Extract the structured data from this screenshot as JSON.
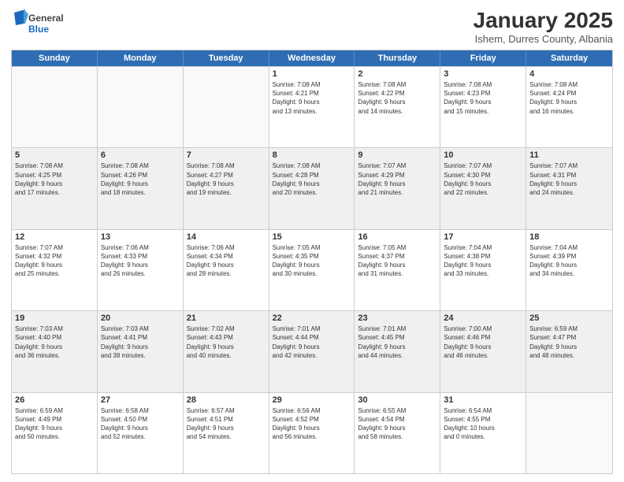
{
  "logo": {
    "general": "General",
    "blue": "Blue"
  },
  "header": {
    "month": "January 2025",
    "location": "Ishem, Durres County, Albania"
  },
  "weekdays": [
    "Sunday",
    "Monday",
    "Tuesday",
    "Wednesday",
    "Thursday",
    "Friday",
    "Saturday"
  ],
  "rows": [
    [
      {
        "day": "",
        "info": "",
        "empty": true
      },
      {
        "day": "",
        "info": "",
        "empty": true
      },
      {
        "day": "",
        "info": "",
        "empty": true
      },
      {
        "day": "1",
        "info": "Sunrise: 7:08 AM\nSunset: 4:21 PM\nDaylight: 9 hours\nand 13 minutes."
      },
      {
        "day": "2",
        "info": "Sunrise: 7:08 AM\nSunset: 4:22 PM\nDaylight: 9 hours\nand 14 minutes."
      },
      {
        "day": "3",
        "info": "Sunrise: 7:08 AM\nSunset: 4:23 PM\nDaylight: 9 hours\nand 15 minutes."
      },
      {
        "day": "4",
        "info": "Sunrise: 7:08 AM\nSunset: 4:24 PM\nDaylight: 9 hours\nand 16 minutes."
      }
    ],
    [
      {
        "day": "5",
        "info": "Sunrise: 7:08 AM\nSunset: 4:25 PM\nDaylight: 9 hours\nand 17 minutes.",
        "shaded": true
      },
      {
        "day": "6",
        "info": "Sunrise: 7:08 AM\nSunset: 4:26 PM\nDaylight: 9 hours\nand 18 minutes.",
        "shaded": true
      },
      {
        "day": "7",
        "info": "Sunrise: 7:08 AM\nSunset: 4:27 PM\nDaylight: 9 hours\nand 19 minutes.",
        "shaded": true
      },
      {
        "day": "8",
        "info": "Sunrise: 7:08 AM\nSunset: 4:28 PM\nDaylight: 9 hours\nand 20 minutes.",
        "shaded": true
      },
      {
        "day": "9",
        "info": "Sunrise: 7:07 AM\nSunset: 4:29 PM\nDaylight: 9 hours\nand 21 minutes.",
        "shaded": true
      },
      {
        "day": "10",
        "info": "Sunrise: 7:07 AM\nSunset: 4:30 PM\nDaylight: 9 hours\nand 22 minutes.",
        "shaded": true
      },
      {
        "day": "11",
        "info": "Sunrise: 7:07 AM\nSunset: 4:31 PM\nDaylight: 9 hours\nand 24 minutes.",
        "shaded": true
      }
    ],
    [
      {
        "day": "12",
        "info": "Sunrise: 7:07 AM\nSunset: 4:32 PM\nDaylight: 9 hours\nand 25 minutes."
      },
      {
        "day": "13",
        "info": "Sunrise: 7:06 AM\nSunset: 4:33 PM\nDaylight: 9 hours\nand 26 minutes."
      },
      {
        "day": "14",
        "info": "Sunrise: 7:06 AM\nSunset: 4:34 PM\nDaylight: 9 hours\nand 28 minutes."
      },
      {
        "day": "15",
        "info": "Sunrise: 7:05 AM\nSunset: 4:35 PM\nDaylight: 9 hours\nand 30 minutes."
      },
      {
        "day": "16",
        "info": "Sunrise: 7:05 AM\nSunset: 4:37 PM\nDaylight: 9 hours\nand 31 minutes."
      },
      {
        "day": "17",
        "info": "Sunrise: 7:04 AM\nSunset: 4:38 PM\nDaylight: 9 hours\nand 33 minutes."
      },
      {
        "day": "18",
        "info": "Sunrise: 7:04 AM\nSunset: 4:39 PM\nDaylight: 9 hours\nand 34 minutes."
      }
    ],
    [
      {
        "day": "19",
        "info": "Sunrise: 7:03 AM\nSunset: 4:40 PM\nDaylight: 9 hours\nand 36 minutes.",
        "shaded": true
      },
      {
        "day": "20",
        "info": "Sunrise: 7:03 AM\nSunset: 4:41 PM\nDaylight: 9 hours\nand 38 minutes.",
        "shaded": true
      },
      {
        "day": "21",
        "info": "Sunrise: 7:02 AM\nSunset: 4:43 PM\nDaylight: 9 hours\nand 40 minutes.",
        "shaded": true
      },
      {
        "day": "22",
        "info": "Sunrise: 7:01 AM\nSunset: 4:44 PM\nDaylight: 9 hours\nand 42 minutes.",
        "shaded": true
      },
      {
        "day": "23",
        "info": "Sunrise: 7:01 AM\nSunset: 4:45 PM\nDaylight: 9 hours\nand 44 minutes.",
        "shaded": true
      },
      {
        "day": "24",
        "info": "Sunrise: 7:00 AM\nSunset: 4:46 PM\nDaylight: 9 hours\nand 46 minutes.",
        "shaded": true
      },
      {
        "day": "25",
        "info": "Sunrise: 6:59 AM\nSunset: 4:47 PM\nDaylight: 9 hours\nand 48 minutes.",
        "shaded": true
      }
    ],
    [
      {
        "day": "26",
        "info": "Sunrise: 6:59 AM\nSunset: 4:49 PM\nDaylight: 9 hours\nand 50 minutes."
      },
      {
        "day": "27",
        "info": "Sunrise: 6:58 AM\nSunset: 4:50 PM\nDaylight: 9 hours\nand 52 minutes."
      },
      {
        "day": "28",
        "info": "Sunrise: 6:57 AM\nSunset: 4:51 PM\nDaylight: 9 hours\nand 54 minutes."
      },
      {
        "day": "29",
        "info": "Sunrise: 6:56 AM\nSunset: 4:52 PM\nDaylight: 9 hours\nand 56 minutes."
      },
      {
        "day": "30",
        "info": "Sunrise: 6:55 AM\nSunset: 4:54 PM\nDaylight: 9 hours\nand 58 minutes."
      },
      {
        "day": "31",
        "info": "Sunrise: 6:54 AM\nSunset: 4:55 PM\nDaylight: 10 hours\nand 0 minutes."
      },
      {
        "day": "",
        "info": "",
        "empty": true
      }
    ]
  ]
}
